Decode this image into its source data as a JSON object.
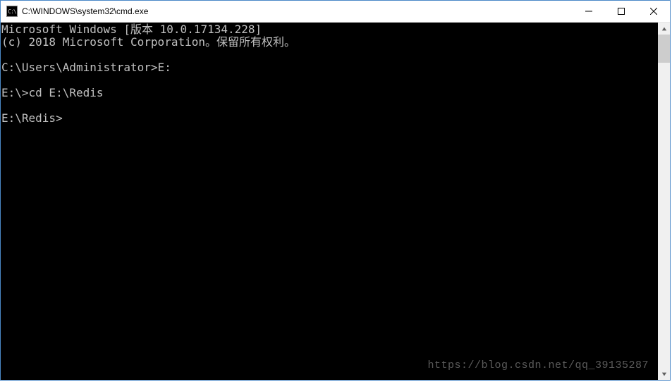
{
  "window": {
    "title": "C:\\WINDOWS\\system32\\cmd.exe",
    "icon_label": "C:\\"
  },
  "terminal": {
    "lines": [
      "Microsoft Windows [版本 10.0.17134.228]",
      "(c) 2018 Microsoft Corporation。保留所有权利。",
      "",
      "C:\\Users\\Administrator>E:",
      "",
      "E:\\>cd E:\\Redis",
      "",
      "E:\\Redis>"
    ]
  },
  "watermark": "https://blog.csdn.net/qq_39135287"
}
